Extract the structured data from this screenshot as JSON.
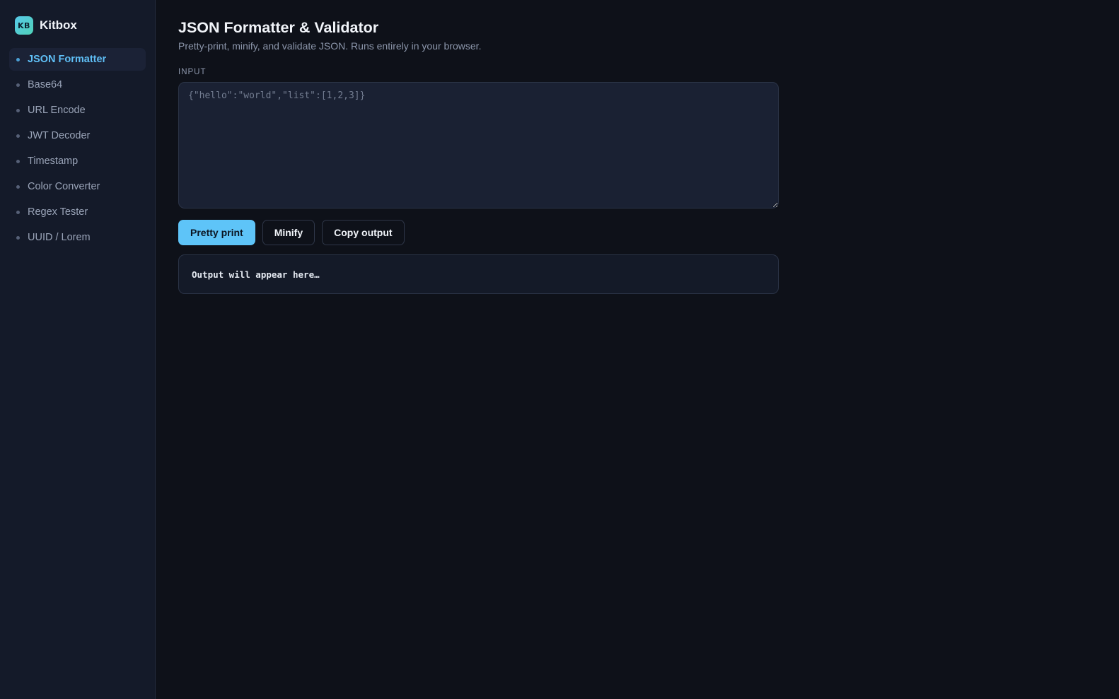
{
  "brand": {
    "logo_text": "KB",
    "name": "Kitbox"
  },
  "sidebar": {
    "items": [
      {
        "label": "JSON Formatter",
        "active": true
      },
      {
        "label": "Base64"
      },
      {
        "label": "URL Encode"
      },
      {
        "label": "JWT Decoder"
      },
      {
        "label": "Timestamp"
      },
      {
        "label": "Color Converter"
      },
      {
        "label": "Regex Tester"
      },
      {
        "label": "UUID / Lorem"
      }
    ]
  },
  "main": {
    "title": "JSON Formatter & Validator",
    "subtitle": "Pretty-print, minify, and validate JSON. Runs entirely in your browser.",
    "input_label": "INPUT",
    "input": {
      "value": "",
      "placeholder": "{\"hello\":\"world\",\"list\":[1,2,3]}"
    },
    "buttons": {
      "pretty_print": "Pretty print",
      "minify": "Minify",
      "copy_output": "Copy output"
    },
    "output_text": "Output will appear here…"
  },
  "colors": {
    "accent": "#5ec4f8",
    "background": "#0e1119",
    "sidebar_bg": "#141a29",
    "active_nav_text": "#5fbff6"
  }
}
